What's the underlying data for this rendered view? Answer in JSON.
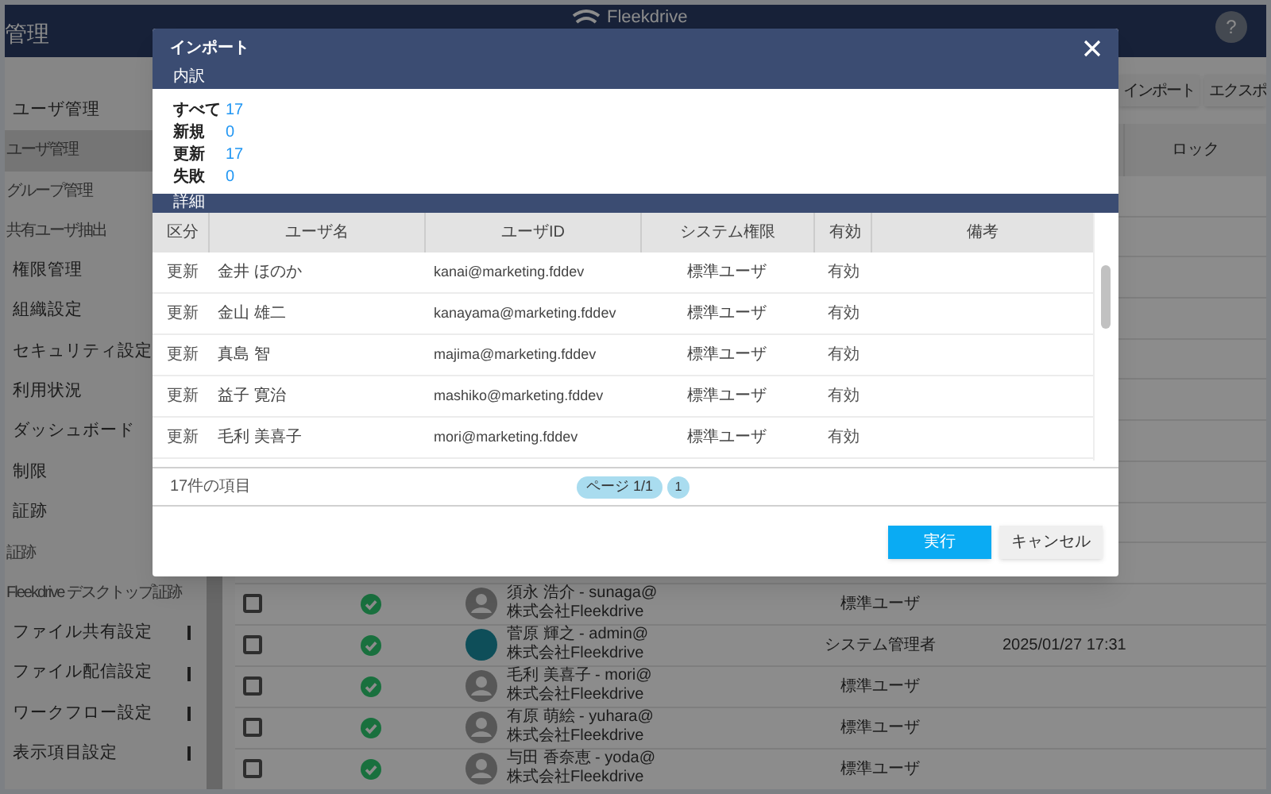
{
  "header": {
    "title": "管理",
    "logo": "Fleekdrive",
    "help": "?"
  },
  "sidebar": {
    "items": [
      {
        "label": "ユーザ管理",
        "kind": "section",
        "selected": false,
        "expandable": false
      },
      {
        "label": "ユーザ管理",
        "kind": "sub",
        "selected": true,
        "expandable": false
      },
      {
        "label": "グループ管理",
        "kind": "sub",
        "selected": false,
        "expandable": false
      },
      {
        "label": "共有ユーザ抽出",
        "kind": "sub",
        "selected": false,
        "expandable": false
      },
      {
        "label": "権限管理",
        "kind": "section",
        "selected": false,
        "expandable": false
      },
      {
        "label": "組織設定",
        "kind": "section",
        "selected": false,
        "expandable": false
      },
      {
        "label": "セキュリティ設定",
        "kind": "section",
        "selected": false,
        "expandable": false
      },
      {
        "label": "利用状況",
        "kind": "section",
        "selected": false,
        "expandable": false
      },
      {
        "label": "ダッシュボード",
        "kind": "section",
        "selected": false,
        "expandable": false
      },
      {
        "label": "制限",
        "kind": "section",
        "selected": false,
        "expandable": false
      },
      {
        "label": "証跡",
        "kind": "section",
        "selected": false,
        "expandable": false
      },
      {
        "label": "証跡",
        "kind": "sub",
        "selected": false,
        "expandable": false
      },
      {
        "label": "Fleekdrive デスクトップ証跡",
        "kind": "sub",
        "selected": false,
        "expandable": false
      },
      {
        "label": "ファイル共有設定",
        "kind": "section",
        "selected": false,
        "expandable": true
      },
      {
        "label": "ファイル配信設定",
        "kind": "section",
        "selected": false,
        "expandable": true
      },
      {
        "label": "ワークフロー設定",
        "kind": "section",
        "selected": false,
        "expandable": true
      },
      {
        "label": "表示項目設定",
        "kind": "section",
        "selected": false,
        "expandable": true
      }
    ]
  },
  "toolbar": {
    "buttons": [
      "インポート",
      "エクスポ"
    ]
  },
  "user_table": {
    "columns": [
      "ロック"
    ],
    "rows": [
      {
        "checked": false,
        "enabled": true,
        "kind": "silhouette",
        "name": "須永 浩介 - sunaga@",
        "company": "株式会社Fleekdrive",
        "role": "標準ユーザ"
      },
      {
        "checked": false,
        "enabled": true,
        "kind": "photo",
        "name": "菅原 輝之 - admin@",
        "company": "株式会社Fleekdrive",
        "role": "システム管理者",
        "last_login": "2025/01/27 17:31"
      },
      {
        "checked": false,
        "enabled": true,
        "kind": "silhouette",
        "name": "毛利 美喜子 - mori@",
        "company": "株式会社Fleekdrive",
        "role": "標準ユーザ"
      },
      {
        "checked": false,
        "enabled": true,
        "kind": "silhouette",
        "name": "有原 萌絵 - yuhara@",
        "company": "株式会社Fleekdrive",
        "role": "標準ユーザ"
      },
      {
        "checked": false,
        "enabled": true,
        "kind": "silhouette",
        "name": "与田 香奈恵 - yoda@",
        "company": "株式会社Fleekdrive",
        "role": "標準ユーザ"
      }
    ]
  },
  "dialog": {
    "title": "インポート",
    "summary_label": "内訳",
    "summary": [
      {
        "label": "すべて",
        "value": "17"
      },
      {
        "label": "新規",
        "value": "0"
      },
      {
        "label": "更新",
        "value": "17"
      },
      {
        "label": "失敗",
        "value": "0"
      }
    ],
    "details_label": "詳細",
    "columns": [
      "区分",
      "ユーザ名",
      "ユーザID",
      "システム権限",
      "有効",
      "備考"
    ],
    "rows": [
      {
        "type": "更新",
        "name": "金井 ほのか",
        "id": "kanai@marketing.fddev",
        "role": "標準ユーザ",
        "valid": "有効"
      },
      {
        "type": "更新",
        "name": "金山 雄二",
        "id": "kanayama@marketing.fddev",
        "role": "標準ユーザ",
        "valid": "有効"
      },
      {
        "type": "更新",
        "name": "真島 智",
        "id": "majima@marketing.fddev",
        "role": "標準ユーザ",
        "valid": "有効"
      },
      {
        "type": "更新",
        "name": "益子 寛治",
        "id": "mashiko@marketing.fddev",
        "role": "標準ユーザ",
        "valid": "有効"
      },
      {
        "type": "更新",
        "name": "毛利 美喜子",
        "id": "mori@marketing.fddev",
        "role": "標準ユーザ",
        "valid": "有効"
      }
    ],
    "item_count": "17件の項目",
    "page_info": "ページ 1/1",
    "pages": [
      {
        "label": "1",
        "selected": true
      }
    ],
    "buttons": [
      {
        "label": "実行",
        "kind": "primary"
      },
      {
        "label": "キャンセル",
        "kind": "secondary"
      }
    ]
  }
}
